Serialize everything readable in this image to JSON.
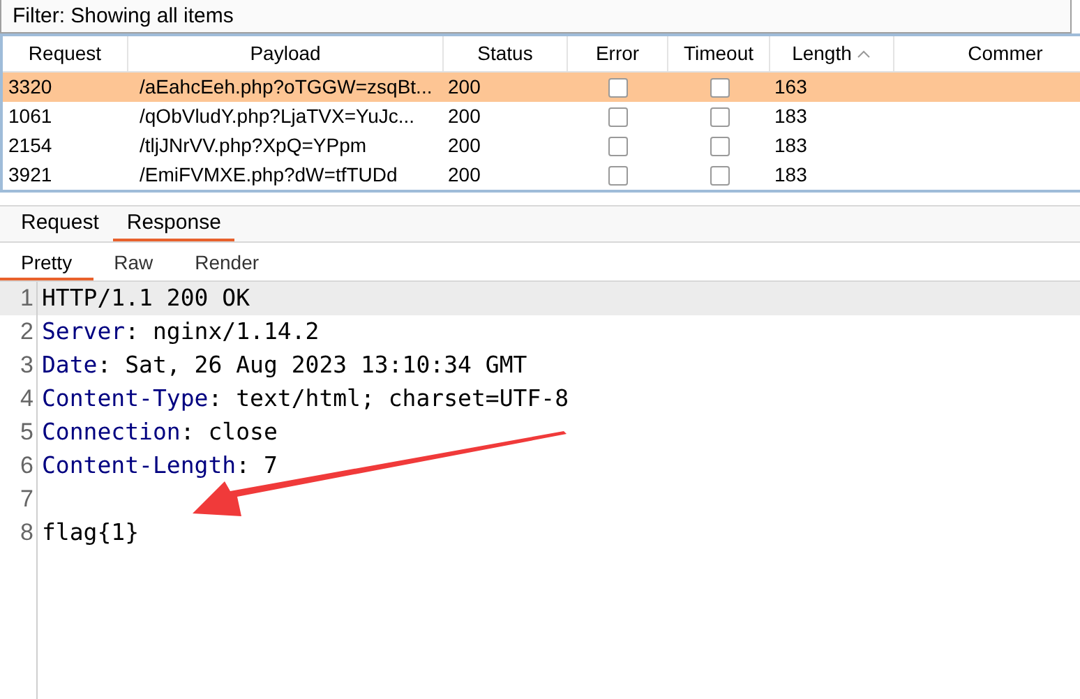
{
  "filter": {
    "text": "Filter: Showing all items"
  },
  "table": {
    "columns": [
      {
        "label": "Request",
        "sorted": false
      },
      {
        "label": "Payload",
        "sorted": false
      },
      {
        "label": "Status",
        "sorted": false
      },
      {
        "label": "Error",
        "sorted": false
      },
      {
        "label": "Timeout",
        "sorted": false
      },
      {
        "label": "Length",
        "sorted": true
      },
      {
        "label": "Commer",
        "sorted": false
      }
    ],
    "rows": [
      {
        "request": "3320",
        "payload": "/aEahcEeh.php?oTGGW=zsqBt...",
        "status": "200",
        "error": false,
        "timeout": false,
        "length": "163",
        "selected": true
      },
      {
        "request": "1061",
        "payload": "/qObVludY.php?LjaTVX=YuJc...",
        "status": "200",
        "error": false,
        "timeout": false,
        "length": "183",
        "selected": false
      },
      {
        "request": "2154",
        "payload": "/tljJNrVV.php?XpQ=YPpm",
        "status": "200",
        "error": false,
        "timeout": false,
        "length": "183",
        "selected": false
      },
      {
        "request": "3921",
        "payload": "/EmiFVMXE.php?dW=tfTUDd",
        "status": "200",
        "error": false,
        "timeout": false,
        "length": "183",
        "selected": false
      }
    ]
  },
  "tabs": [
    {
      "label": "Request",
      "selected": false
    },
    {
      "label": "Response",
      "selected": true
    }
  ],
  "view_tabs": [
    {
      "label": "Pretty",
      "selected": true
    },
    {
      "label": "Raw",
      "selected": false
    },
    {
      "label": "Render",
      "selected": false
    }
  ],
  "editor": {
    "lines": [
      {
        "number": "1",
        "text": "HTTP/1.1 200 OK",
        "selected": true
      },
      {
        "number": "2",
        "key": "Server",
        "text": ": nginx/1.14.2",
        "selected": false
      },
      {
        "number": "3",
        "key": "Date",
        "text": ": Sat, 26 Aug 2023 13:10:34 GMT",
        "selected": false
      },
      {
        "number": "4",
        "key": "Content-Type",
        "text": ": text/html; charset=UTF-8",
        "selected": false
      },
      {
        "number": "5",
        "key": "Connection",
        "text": ": close",
        "selected": false
      },
      {
        "number": "6",
        "key": "Content-Length",
        "text": ": 7",
        "selected": false
      },
      {
        "number": "7",
        "selected": false
      },
      {
        "number": "8",
        "text": "flag{1}",
        "selected": false
      }
    ]
  }
}
